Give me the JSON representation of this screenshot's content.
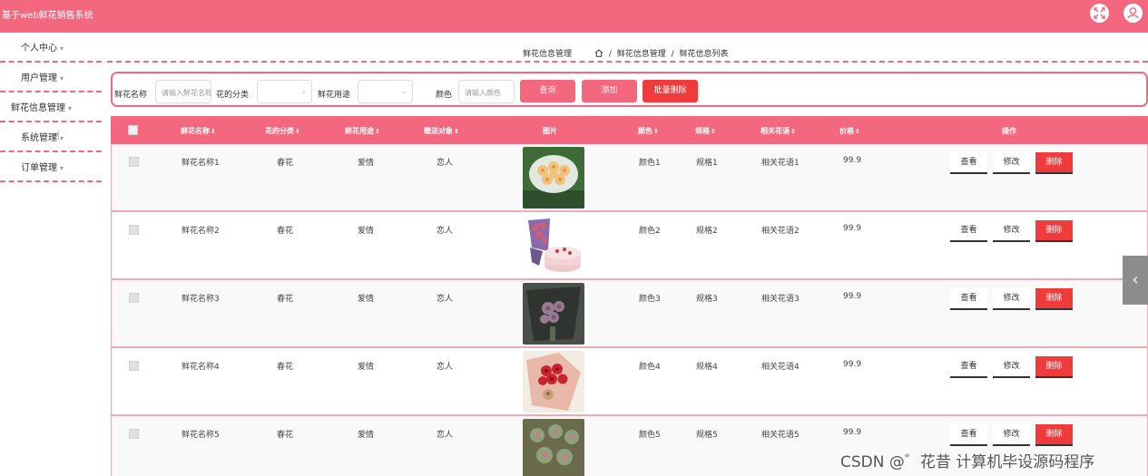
{
  "app": {
    "title": "基于web鲜花销售系统"
  },
  "topbar": {
    "fullscreen_icon": "expand-icon",
    "user_icon": "user-icon"
  },
  "sidebar": {
    "items": [
      {
        "label": "个人中心"
      },
      {
        "label": "用户管理"
      },
      {
        "label": "鲜花信息管理"
      },
      {
        "label": "系统管理"
      },
      {
        "label": "订单管理"
      }
    ],
    "caret": "▾"
  },
  "breadcrumb": {
    "heading": "鲜花信息管理",
    "home_icon": "home-icon",
    "sep": "/",
    "level1": "鲜花信息管理",
    "level2": "鲜花信息列表"
  },
  "filters": {
    "name_label": "鲜花名称",
    "name_placeholder": "请输入鲜花名称",
    "category_label": "花的分类",
    "usage_label": "鲜花用途",
    "color_label": "颜色",
    "color_placeholder": "请输入颜色",
    "query_button": "查询",
    "add_button": "添加",
    "batch_delete_button": "批量删除"
  },
  "table": {
    "headers": {
      "name": "鲜花名称",
      "category": "花的分类",
      "usage": "鲜花用途",
      "target": "赠送对象",
      "image": "图片",
      "color": "颜色",
      "spec": "规格",
      "related": "相关花语",
      "price": "价格",
      "actions": "操作",
      "sort": "⇕"
    },
    "action_labels": {
      "view": "查看",
      "edit": "修改",
      "delete": "删除"
    },
    "rows": [
      {
        "name": "鲜花名称1",
        "category": "春花",
        "usage": "爱情",
        "target": "恋人",
        "image": "peach-rose-bouquet",
        "color": "颜色1",
        "spec": "规格1",
        "related": "相关花语1",
        "price": "99.9"
      },
      {
        "name": "鲜花名称2",
        "category": "春花",
        "usage": "爱情",
        "target": "恋人",
        "image": "bouquet-with-cake",
        "color": "颜色2",
        "spec": "规格2",
        "related": "相关花语2",
        "price": "99.9"
      },
      {
        "name": "鲜花名称3",
        "category": "春花",
        "usage": "爱情",
        "target": "恋人",
        "image": "dark-wrapped-bouquet",
        "color": "颜色3",
        "spec": "规格3",
        "related": "相关花语3",
        "price": "99.9"
      },
      {
        "name": "鲜花名称4",
        "category": "春花",
        "usage": "爱情",
        "target": "恋人",
        "image": "red-rose-bouquet",
        "color": "颜色4",
        "spec": "规格4",
        "related": "相关花语4",
        "price": "99.9"
      },
      {
        "name": "鲜花名称5",
        "category": "春花",
        "usage": "爱情",
        "target": "恋人",
        "image": "succulent-bouquet",
        "color": "颜色5",
        "spec": "规格5",
        "related": "相关花语5",
        "price": "99.9"
      }
    ]
  },
  "side_tab": {
    "icon": "chevron-left-icon",
    "glyph": "‹"
  },
  "watermark": {
    "text": "CSDN @゛花昔 计算机毕设源码程序"
  },
  "colors": {
    "primary": "#f4687f",
    "danger": "#ef3b3b",
    "tab": "#8c8c8c"
  }
}
